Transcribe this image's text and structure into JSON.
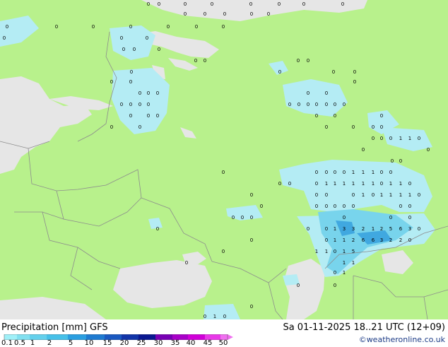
{
  "legend": {
    "title": "Precipitation [mm]  GFS",
    "datetime": "Sa 01-11-2025 18..21 UTC (12+09)",
    "credit": "©weatheronline.co.uk",
    "scale_ticks": [
      "0.1",
      "0.5",
      "1",
      "2",
      "5",
      "10",
      "15",
      "20",
      "25",
      "30",
      "35",
      "40",
      "45",
      "50"
    ],
    "scale_colors": [
      "#a0f0f8",
      "#82e0f0",
      "#64d0ec",
      "#46c0e8",
      "#2a9ee0",
      "#1e7ad0",
      "#1a58c0",
      "#1234a8",
      "#0a1890",
      "#7800b4",
      "#a800c8",
      "#d000d8",
      "#e838e8",
      "#f070f0"
    ]
  },
  "map": {
    "land_color": "#b8f18c",
    "water_color": "#e6e6e6",
    "precip_light": "#b4ecf4",
    "precip_mid": "#78d4ec",
    "precip_heavy": "#40a8e0",
    "border_color": "#8c8c8c"
  }
}
